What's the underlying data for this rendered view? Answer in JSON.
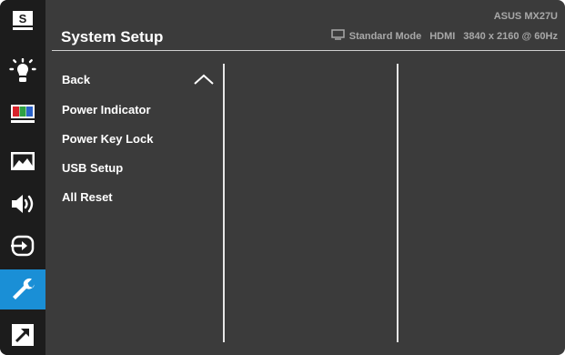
{
  "header": {
    "title": "System Setup",
    "model": "ASUS MX27U",
    "mode": "Standard Mode",
    "input": "HDMI",
    "resolution": "3840 x 2160 @ 60Hz"
  },
  "sidebar": {
    "items": [
      {
        "icon": "splendid-s-icon",
        "active": false
      },
      {
        "icon": "brightness-icon",
        "active": false
      },
      {
        "icon": "color-bars-icon",
        "active": false
      },
      {
        "icon": "image-icon",
        "active": false
      },
      {
        "icon": "sound-icon",
        "active": false
      },
      {
        "icon": "input-select-icon",
        "active": false
      },
      {
        "icon": "wrench-icon",
        "active": true
      },
      {
        "icon": "shortcut-arrow-icon",
        "active": false
      }
    ],
    "s_letter": "S"
  },
  "menu": {
    "items": [
      {
        "label": "Back"
      },
      {
        "label": "Power Indicator"
      },
      {
        "label": "Power Key Lock"
      },
      {
        "label": "USB Setup"
      },
      {
        "label": "All Reset"
      }
    ]
  },
  "colors": {
    "background": "#3b3b3b",
    "sidebar": "#1c1c1c",
    "active": "#1a8fd6",
    "text": "#ffffff",
    "status_text": "#a8a8a8"
  }
}
